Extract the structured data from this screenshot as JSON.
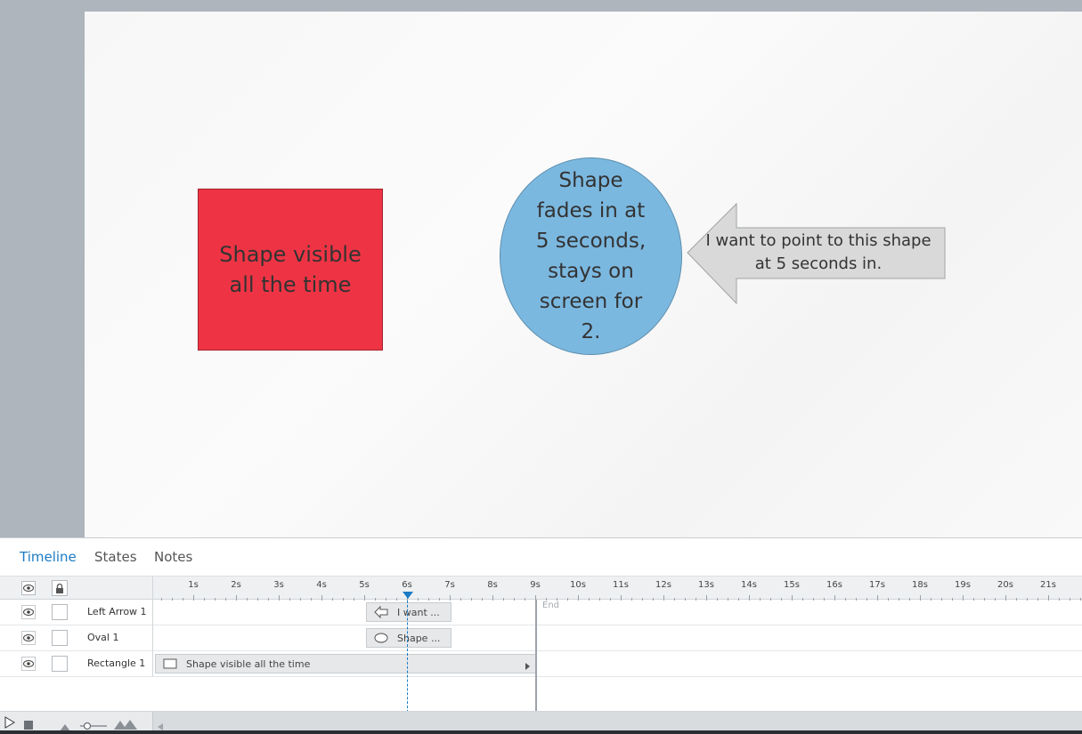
{
  "stage": {
    "rectangle_text": "Shape visible all the time",
    "oval_text": "Shape fades in at 5 seconds, stays on screen for 2.",
    "arrow_text": "I want to point to this shape at 5 seconds in.",
    "colors": {
      "rectangle": "#ee3444",
      "oval": "#7bb8e0",
      "arrow": "#d9d9d9"
    }
  },
  "panel": {
    "tabs": [
      {
        "label": "Timeline",
        "active": true
      },
      {
        "label": "States",
        "active": false
      },
      {
        "label": "Notes",
        "active": false
      }
    ]
  },
  "timeline": {
    "ticks": [
      "1s",
      "2s",
      "3s",
      "4s",
      "5s",
      "6s",
      "7s",
      "8s",
      "9s",
      "10s",
      "11s",
      "12s",
      "13s",
      "14s",
      "15s",
      "16s",
      "17s",
      "18s",
      "19s",
      "20s",
      "21s"
    ],
    "end_label": "End",
    "playhead_seconds": 6,
    "layers": [
      {
        "name": "Left Arrow 1",
        "clip_label": "I want ...",
        "start": 5,
        "end": 7,
        "icon": "left-arrow-icon"
      },
      {
        "name": "Oval 1",
        "clip_label": "Shape ...",
        "start": 5,
        "end": 7,
        "icon": "oval-icon"
      },
      {
        "name": "Rectangle 1",
        "clip_label": "Shape visible all the time",
        "start": 0,
        "end": 9,
        "icon": "rectangle-icon"
      }
    ]
  }
}
